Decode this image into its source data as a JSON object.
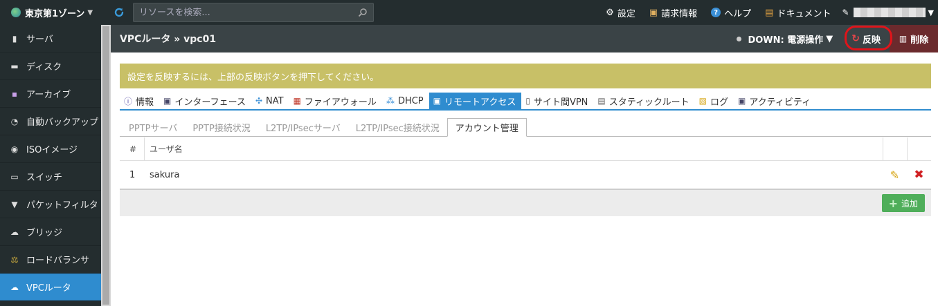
{
  "topbar": {
    "zone": "東京第1ゾーン",
    "search_placeholder": "リソースを検索...",
    "links": [
      {
        "icon": "gear-icon",
        "glyph": "⚙",
        "label": "設定"
      },
      {
        "icon": "billing-icon",
        "glyph": "▣",
        "label": "請求情報"
      },
      {
        "icon": "help-icon",
        "glyph": "?",
        "label": "ヘルプ"
      },
      {
        "icon": "document-icon",
        "glyph": "▤",
        "label": "ドキュメント"
      }
    ]
  },
  "sidebar": {
    "items": [
      {
        "label": "サーバ",
        "glyph": "▮",
        "icon": "server-icon"
      },
      {
        "label": "ディスク",
        "glyph": "▬",
        "icon": "disk-icon"
      },
      {
        "label": "アーカイブ",
        "glyph": "▪",
        "icon": "archive-icon"
      },
      {
        "label": "自動バックアップ",
        "glyph": "◔",
        "icon": "backup-icon"
      },
      {
        "label": "ISOイメージ",
        "glyph": "◉",
        "icon": "iso-icon"
      },
      {
        "label": "スイッチ",
        "glyph": "▭",
        "icon": "switch-icon"
      },
      {
        "label": "パケットフィルタ",
        "glyph": "▼",
        "icon": "filter-icon"
      },
      {
        "label": "ブリッジ",
        "glyph": "☁",
        "icon": "bridge-icon"
      },
      {
        "label": "ロードバランサ",
        "glyph": "⚖",
        "icon": "loadbalancer-icon"
      },
      {
        "label": "VPCルータ",
        "glyph": "☁",
        "icon": "vpc-router-icon",
        "active": true
      }
    ]
  },
  "header": {
    "breadcrumb": "VPCルータ » vpc01",
    "status": "DOWN: 電源操作",
    "apply_label": "反映",
    "delete_label": "削除"
  },
  "notice": "設定を反映するには、上部の反映ボタンを押下してください。",
  "tabs": [
    {
      "label": "情報",
      "glyph": "ⓘ",
      "icon": "info-icon"
    },
    {
      "label": "インターフェース",
      "glyph": "▣",
      "icon": "interface-icon"
    },
    {
      "label": "NAT",
      "glyph": "✣",
      "icon": "nat-icon"
    },
    {
      "label": "ファイアウォール",
      "glyph": "▦",
      "icon": "firewall-icon"
    },
    {
      "label": "DHCP",
      "glyph": "⁂",
      "icon": "dhcp-icon"
    },
    {
      "label": "リモートアクセス",
      "glyph": "▣",
      "icon": "remote-access-icon",
      "active": true
    },
    {
      "label": "サイト間VPN",
      "glyph": "▯",
      "icon": "site-vpn-icon"
    },
    {
      "label": "スタティックルート",
      "glyph": "▤",
      "icon": "static-route-icon"
    },
    {
      "label": "ログ",
      "glyph": "▧",
      "icon": "log-icon"
    },
    {
      "label": "アクティビティ",
      "glyph": "▣",
      "icon": "activity-icon"
    }
  ],
  "subtabs": [
    {
      "label": "PPTPサーバ"
    },
    {
      "label": "PPTP接続状況"
    },
    {
      "label": "L2TP/IPsecサーバ"
    },
    {
      "label": "L2TP/IPsec接続状況"
    },
    {
      "label": "アカウント管理",
      "active": true
    }
  ],
  "table": {
    "columns": [
      "#",
      "ユーザ名"
    ],
    "rows": [
      {
        "num": "1",
        "username": "sakura"
      }
    ],
    "add_label": "追加"
  }
}
